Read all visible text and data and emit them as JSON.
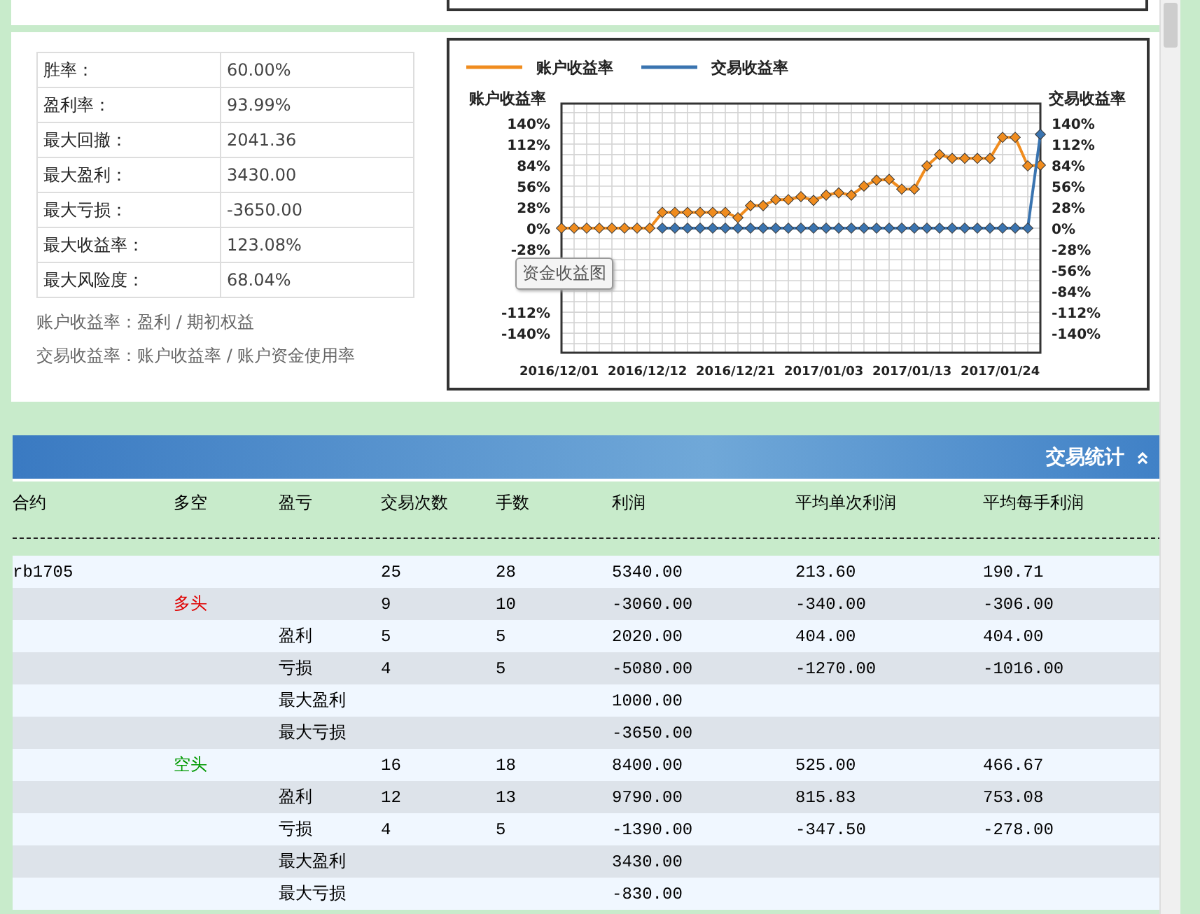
{
  "stats": [
    {
      "label": "胜率：",
      "value": "60.00%"
    },
    {
      "label": "盈利率：",
      "value": "93.99%"
    },
    {
      "label": "最大回撤：",
      "value": "2041.36"
    },
    {
      "label": "最大盈利：",
      "value": "3430.00"
    },
    {
      "label": "最大亏损：",
      "value": "-3650.00"
    },
    {
      "label": "最大收益率：",
      "value": "123.08%"
    },
    {
      "label": "最大风险度：",
      "value": "68.04%"
    }
  ],
  "notes": [
    "账户收益率：盈利 / 期初权益",
    "交易收益率：账户收益率 / 账户资金使用率"
  ],
  "chart": {
    "tooltip": "资金收益图",
    "right_axis_title": "交易收益率",
    "right_tick_labels": [
      "140%",
      "112%",
      "84%",
      "56%",
      "28%",
      "0%",
      "-28%",
      "-56%",
      "-84%",
      "-112%",
      "-140%"
    ],
    "chart_data": {
      "type": "line",
      "ylabel": "账户收益率",
      "ylim": [
        -166,
        166
      ],
      "grid": true,
      "legend": "top",
      "categories": [
        "2016/12/01",
        null,
        null,
        null,
        null,
        null,
        null,
        "2016/12/12",
        null,
        null,
        null,
        null,
        null,
        null,
        "2016/12/21",
        null,
        null,
        null,
        null,
        null,
        null,
        "2017/01/03",
        null,
        null,
        null,
        null,
        null,
        null,
        "2017/01/13",
        null,
        null,
        null,
        null,
        null,
        null,
        "2017/01/24",
        null,
        null,
        null
      ],
      "yticks": [
        {
          "value": 140,
          "label": "140%"
        },
        {
          "value": 112,
          "label": "112%"
        },
        {
          "value": 84,
          "label": "84%"
        },
        {
          "value": 56,
          "label": "56%"
        },
        {
          "value": 28,
          "label": "28%"
        },
        {
          "value": 0,
          "label": "0%"
        },
        {
          "value": -28,
          "label": "-28%"
        },
        {
          "value": -112,
          "label": "-112%"
        },
        {
          "value": -140,
          "label": "-140%"
        }
      ],
      "series": [
        {
          "name": "账户收益率",
          "color": "#f08c1e",
          "marker": "diamond",
          "values": [
            0,
            0,
            0,
            0,
            0,
            0,
            0,
            0,
            21,
            21,
            21,
            21,
            21,
            21,
            14,
            30,
            30,
            38,
            38,
            42,
            37,
            44,
            47,
            44,
            56,
            64,
            65,
            52,
            52,
            83,
            98,
            93,
            93,
            93,
            93,
            121,
            121,
            83,
            84
          ]
        },
        {
          "name": "交易收益率",
          "color": "#3a74b0",
          "marker": "diamond",
          "values": [
            null,
            null,
            null,
            null,
            null,
            null,
            null,
            null,
            0,
            0,
            0,
            0,
            0,
            0,
            0,
            0,
            0,
            0,
            0,
            0,
            0,
            0,
            0,
            0,
            0,
            0,
            0,
            0,
            0,
            0,
            0,
            0,
            0,
            0,
            0,
            0,
            0,
            0,
            125
          ]
        }
      ]
    }
  },
  "section": {
    "title": "交易统计"
  },
  "columns": [
    "合约",
    "多空",
    "盈亏",
    "交易次数",
    "手数",
    "利润",
    "平均单次利润",
    "平均每手利润"
  ],
  "rows": [
    {
      "contract": "rb1705",
      "trades": "25",
      "lots": "28",
      "profit": "5340.00",
      "avg_trade": "213.60",
      "avg_lot": "190.71"
    },
    {
      "direction": "多头",
      "color": "#e00000",
      "trades": "9",
      "lots": "10",
      "profit": "-3060.00",
      "avg_trade": "-340.00",
      "avg_lot": "-306.00"
    },
    {
      "pnl": "盈利",
      "trades": "5",
      "lots": "5",
      "profit": "2020.00",
      "avg_trade": "404.00",
      "avg_lot": "404.00"
    },
    {
      "pnl": "亏损",
      "trades": "4",
      "lots": "5",
      "profit": "-5080.00",
      "avg_trade": "-1270.00",
      "avg_lot": "-1016.00"
    },
    {
      "pnl": "最大盈利",
      "profit": "1000.00"
    },
    {
      "pnl": "最大亏损",
      "profit": "-3650.00"
    },
    {
      "direction": "空头",
      "color": "#009900",
      "trades": "16",
      "lots": "18",
      "profit": "8400.00",
      "avg_trade": "525.00",
      "avg_lot": "466.67"
    },
    {
      "pnl": "盈利",
      "trades": "12",
      "lots": "13",
      "profit": "9790.00",
      "avg_trade": "815.83",
      "avg_lot": "753.08"
    },
    {
      "pnl": "亏损",
      "trades": "4",
      "lots": "5",
      "profit": "-1390.00",
      "avg_trade": "-347.50",
      "avg_lot": "-278.00"
    },
    {
      "pnl": "最大盈利",
      "profit": "3430.00"
    },
    {
      "pnl": "最大亏损",
      "profit": "-830.00"
    }
  ]
}
